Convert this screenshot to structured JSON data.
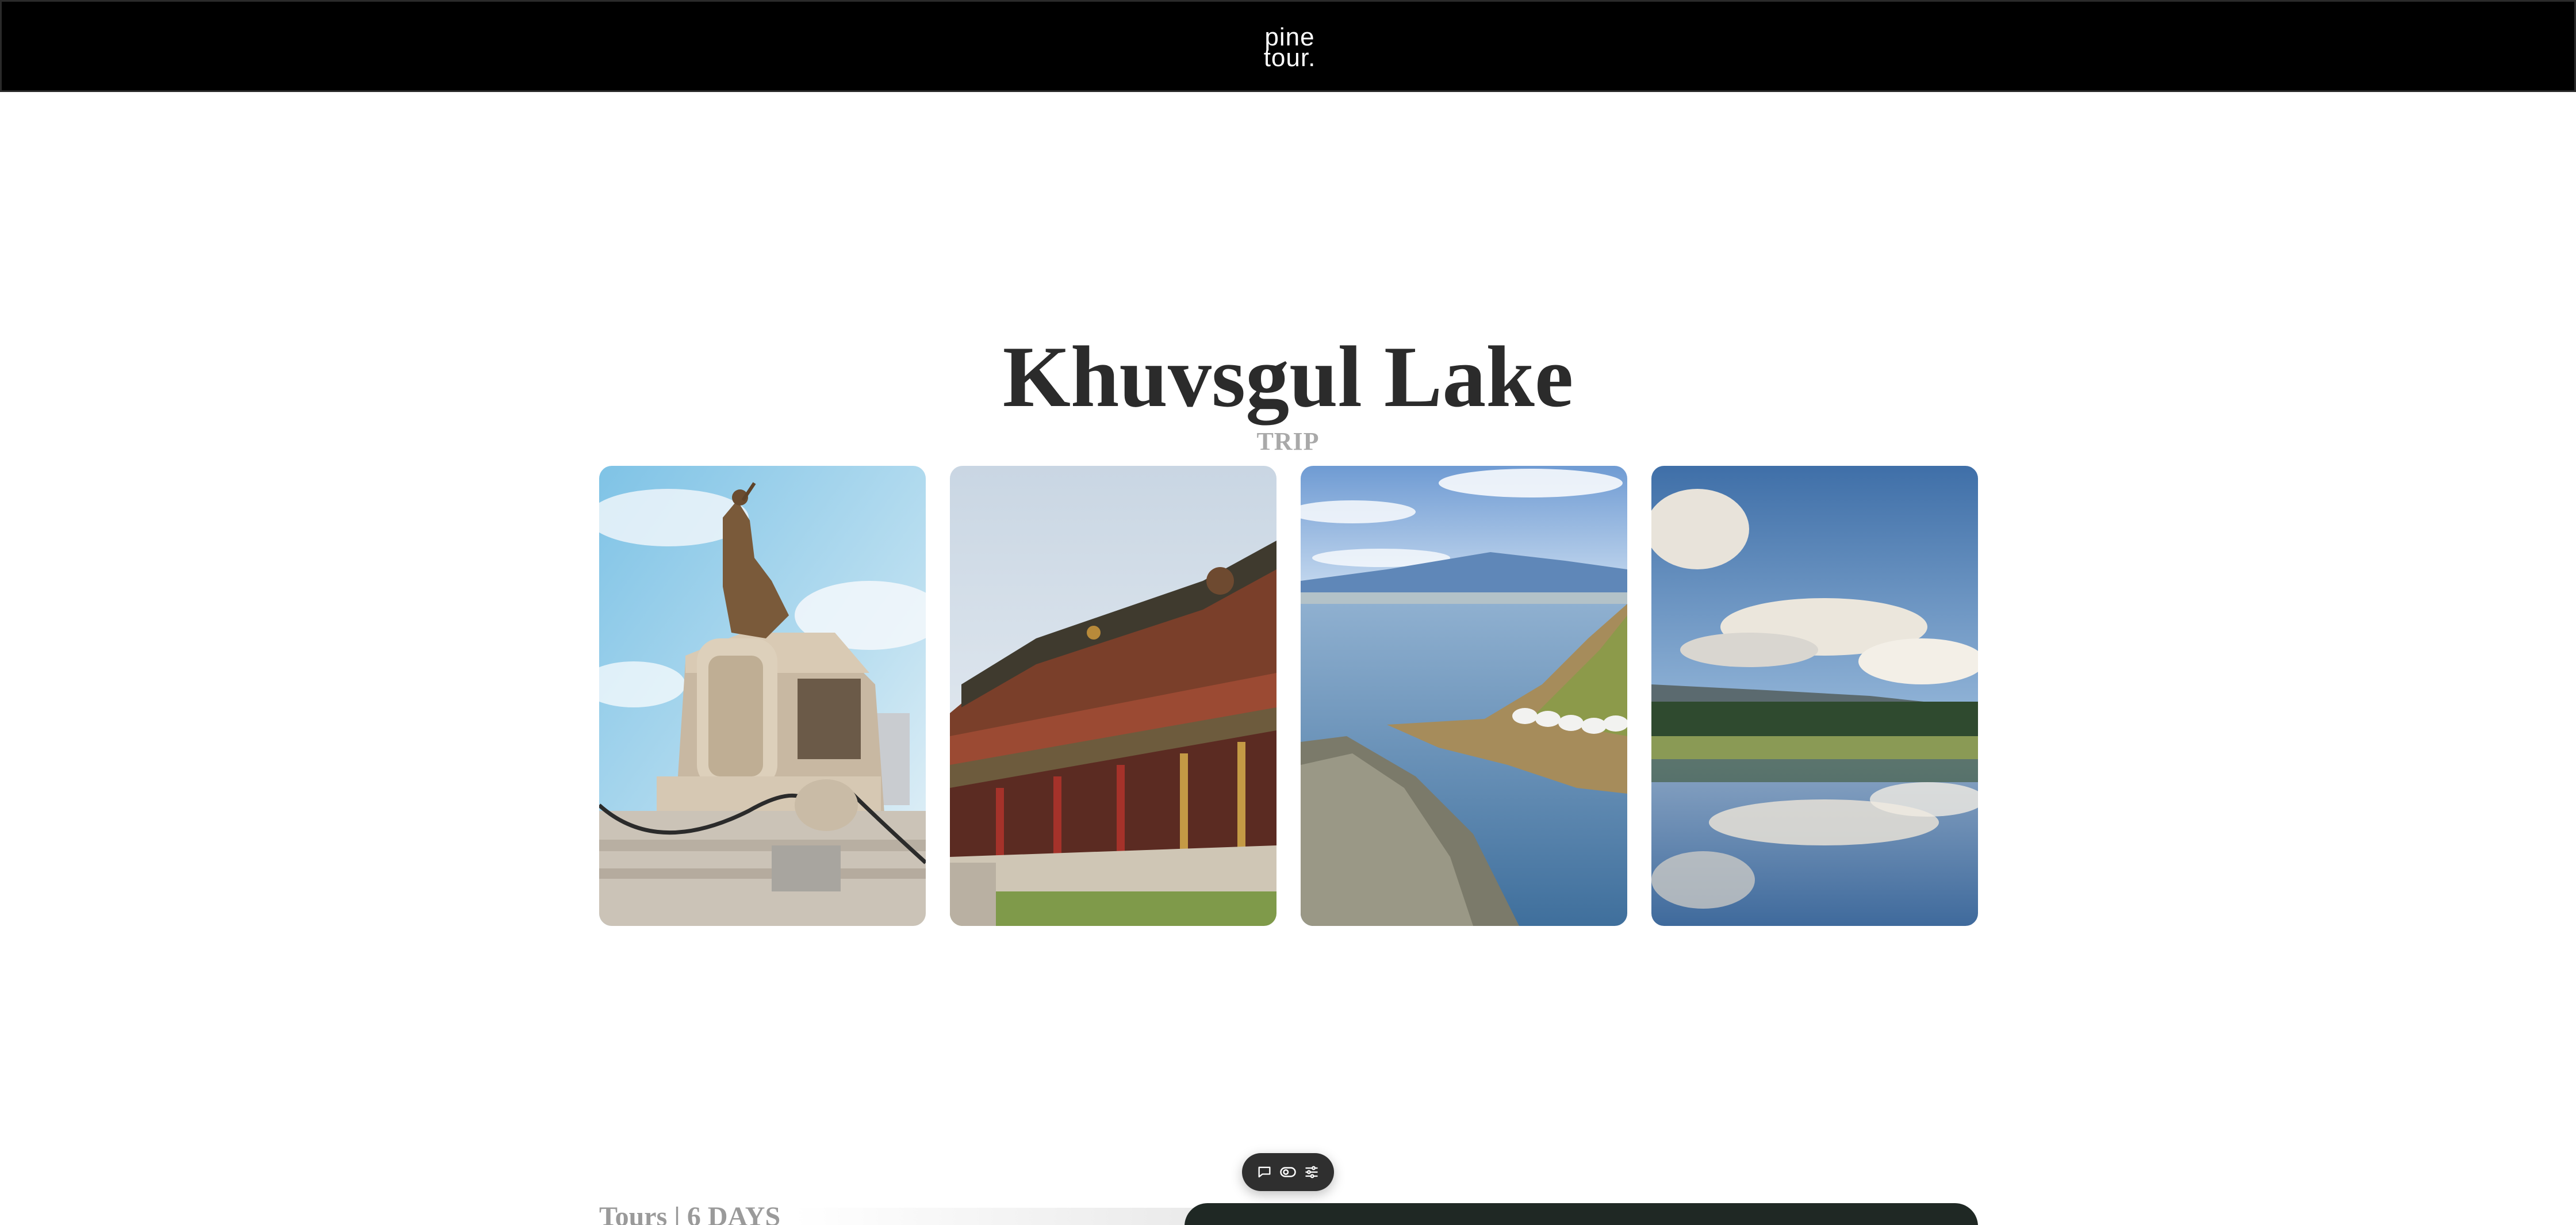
{
  "header": {
    "logo_line1": "pine",
    "logo_line2": "tour."
  },
  "hero": {
    "title": "Khuvsgul Lake",
    "subtitle": "TRIP"
  },
  "gallery": {
    "images": [
      {
        "name": "chinggis-khaan-statue-photo"
      },
      {
        "name": "amarbayasgalant-monastery-photo"
      },
      {
        "name": "khuvsgul-lake-shore-photo"
      },
      {
        "name": "meadow-reflection-photo"
      }
    ]
  },
  "toolbar": {
    "icons": [
      "chat-bubble-icon",
      "toggle-icon",
      "settings-sliders-icon"
    ]
  },
  "tours": {
    "heading": "Tours | 6 DAYS"
  },
  "colors": {
    "header_bg": "#000000",
    "title": "#2b2b2b",
    "subtitle": "#a9a9a9",
    "toolbar_bg": "#2f2f2f"
  }
}
